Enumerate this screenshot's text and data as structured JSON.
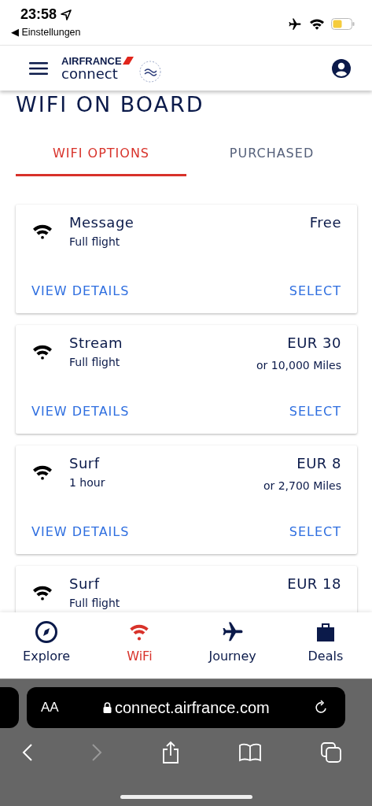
{
  "status_bar": {
    "time": "23:58",
    "back_label": "◀ Einstellungen"
  },
  "header": {
    "brand": "AIRFRANCE",
    "product": "connect"
  },
  "page": {
    "title": "WIFI ON BOARD"
  },
  "tabs": [
    {
      "label": "WIFI OPTIONS",
      "selected": true
    },
    {
      "label": "PURCHASED",
      "selected": false
    }
  ],
  "options": [
    {
      "name": "Message",
      "duration": "Full flight",
      "price": "Free",
      "actions": [
        "VIEW DETAILS",
        "SELECT"
      ]
    },
    {
      "name": "Stream",
      "duration": "Full flight",
      "price": "EUR 30",
      "miles": "or 10,000 Miles",
      "actions": [
        "VIEW DETAILS",
        "SELECT"
      ]
    },
    {
      "name": "Surf",
      "duration": "1 hour",
      "price": "EUR 8",
      "miles": "or 2,700 Miles",
      "actions": [
        "VIEW DETAILS",
        "SELECT"
      ]
    },
    {
      "name": "Surf",
      "duration": "Full flight",
      "price": "EUR 18"
    }
  ],
  "bottom_nav": [
    {
      "label": "Explore",
      "kind": "compass",
      "selected": false
    },
    {
      "label": "WiFi",
      "kind": "wifi",
      "selected": true
    },
    {
      "label": "Journey",
      "kind": "plane",
      "selected": false
    },
    {
      "label": "Deals",
      "kind": "bag",
      "selected": false
    }
  ],
  "browser": {
    "text_size": "AA",
    "url": "connect.airfrance.com"
  }
}
